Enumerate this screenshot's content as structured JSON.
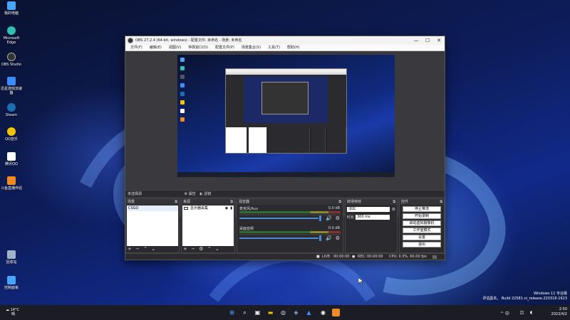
{
  "desktop": {
    "icons": [
      {
        "label": "我的电脑",
        "color": "#4aa3ff"
      },
      {
        "label": "Microsoft Edge",
        "color": "#2fc0b0"
      },
      {
        "label": "OBS Studio",
        "color": "#333333"
      },
      {
        "label": "迅星游戏加速器",
        "color": "#3a8cff"
      },
      {
        "label": "Steam",
        "color": "#1b6fb0"
      },
      {
        "label": "QQ音乐",
        "color": "#f5c400"
      },
      {
        "label": "腾讯QQ",
        "color": "#ffffff"
      },
      {
        "label": "斗鱼直播伴侣",
        "color": "#f08a24"
      },
      {
        "label": "回收站",
        "color": "#9fb3c8"
      },
      {
        "label": "控制面板",
        "color": "#4aa3ff"
      }
    ]
  },
  "obs": {
    "title": "OBS 27.2.4 (64-bit, windows) - 配置文件: 未命名 - 场景: 未命名",
    "window_controls": {
      "minimize": "—",
      "maximize": "☐",
      "close": "✕"
    },
    "menu": [
      "文件(F)",
      "编辑(E)",
      "视图(V)",
      "停靠窗口(D)",
      "配置文件(P)",
      "场景集合(S)",
      "工具(T)",
      "帮助(H)"
    ],
    "scene_bar": {
      "label": "未选择源"
    },
    "props_buttons": {
      "properties": "属性",
      "filters": "滤镜"
    },
    "docks": {
      "scenes": {
        "title": "场景",
        "items": [
          "CSGO"
        ]
      },
      "sources": {
        "title": "来源",
        "items": [
          {
            "name": "显示器采集"
          }
        ]
      },
      "mixer": {
        "title": "混音器",
        "tracks": [
          {
            "name": "麦克风/Aux",
            "db": "0.0 dB"
          },
          {
            "name": "桌面音频",
            "db": "0.0 dB"
          }
        ]
      },
      "transitions": {
        "title": "转场特效",
        "type": "淡出",
        "duration_label": "时长",
        "duration_value": "300 ms"
      },
      "controls": {
        "title": "控件",
        "buttons": [
          "停止推流",
          "开始录制",
          "启动虚拟摄像机",
          "工作室模式",
          "设置",
          "退出"
        ]
      }
    },
    "footer_glyphs": {
      "add": "+",
      "remove": "−",
      "gear": "⚙",
      "up": "⌃",
      "down": "⌄"
    },
    "status": {
      "live_label": "LIVE:",
      "live_time": "00:00:00",
      "rec_label": "REC:",
      "rec_time": "00:00:00",
      "cpu": "CPU: 0.3%, 60.00 fps"
    }
  },
  "watermark": {
    "line1": "Windows 11 专业版",
    "line2": "评估副本。 Build 22581.ni_release.220318-1623"
  },
  "taskbar": {
    "weather_temp": "14°C",
    "weather_desc": "晴",
    "time": "2:50",
    "date": "2022/4/2",
    "tray_text": "^  中"
  }
}
